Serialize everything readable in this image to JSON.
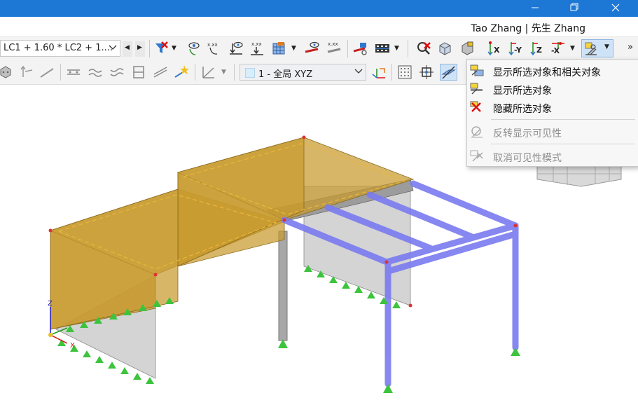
{
  "window": {
    "restore_glyph": "❐",
    "close_glyph": "✕"
  },
  "user": {
    "label": "Tao Zhang | 先生 Zhang"
  },
  "toolbar1": {
    "load_combo_value": "LC1 + 1.60 * LC2 + 1....",
    "label_xxx": "x.xx",
    "nav_prev": "◀",
    "nav_next": "▶",
    "axis_x": "X",
    "axis_neg_y": "-Y",
    "axis_z": "Z",
    "axis_neg_x": "-X",
    "overflow": "»"
  },
  "toolbar2": {
    "view_combo_value": "1 - 全局 XYZ"
  },
  "menu": {
    "items": [
      {
        "label": "显示所选对象和相关对象",
        "icon": "show-selected-related-icon",
        "enabled": true
      },
      {
        "label": "显示所选对象",
        "icon": "show-selected-icon",
        "enabled": true
      },
      {
        "label": "隐藏所选对象",
        "icon": "hide-selected-icon",
        "enabled": true
      },
      {
        "label": "反转显示可见性",
        "icon": "invert-visibility-icon",
        "enabled": false
      },
      {
        "label": "取消可见性模式",
        "icon": "cancel-visibility-mode-icon",
        "enabled": false
      }
    ]
  },
  "scene": {
    "axis_z_label": "Z",
    "axis_x_label": "X",
    "colors": {
      "surface": "#c89a2e",
      "member_selected": "#7b7bf0",
      "support": "#3cc43c",
      "node": "#e03030"
    }
  }
}
